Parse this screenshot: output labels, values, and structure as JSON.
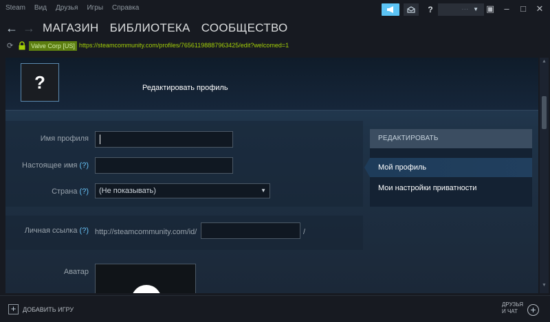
{
  "menu": {
    "items": [
      "Steam",
      "Вид",
      "Друзья",
      "Игры",
      "Справка"
    ]
  },
  "topbar": {
    "help_label": "?",
    "account_label": "···",
    "window_buttons": [
      "▣",
      "–",
      "□",
      "✕"
    ]
  },
  "nav": {
    "back": "←",
    "forward": "→",
    "links": [
      "МАГАЗИН",
      "БИБЛИОТЕКА",
      "СООБЩЕСТВО"
    ]
  },
  "urlbar": {
    "refresh": "⟳",
    "certificate": "Valve Corp [US]",
    "url": "https://steamcommunity.com/profiles/76561198887963425/edit?welcomed=1"
  },
  "header": {
    "avatar_placeholder": "?",
    "title": "Редактировать профиль"
  },
  "form": {
    "profile_name_label": "Имя профиля",
    "profile_name_value": "",
    "real_name_label": "Настоящее имя",
    "real_name_help": "(?)",
    "real_name_value": "",
    "country_label": "Страна",
    "country_help": "(?)",
    "country_value": "(Не показывать)",
    "custom_url_label": "Личная ссылка",
    "custom_url_help": "(?)",
    "custom_url_prefix": "http://steamcommunity.com/id/",
    "custom_url_value": "",
    "custom_url_suffix": "/",
    "avatar_label": "Аватар"
  },
  "panel": {
    "header": "РЕДАКТИРОВАТЬ",
    "items": [
      "Мой профиль",
      "Мои настройки приватности"
    ]
  },
  "footer": {
    "add_game_plus": "+",
    "add_game": "ДОБАВИТЬ ИГРУ",
    "friends_line1": "ДРУЗЬЯ",
    "friends_line2": "И ЧАТ",
    "friends_plus": "+"
  },
  "colors": {
    "accent": "#66c0f4",
    "announce": "#5cc4f5",
    "url_green": "#a4d007",
    "cert_bg": "#5c7e10"
  }
}
